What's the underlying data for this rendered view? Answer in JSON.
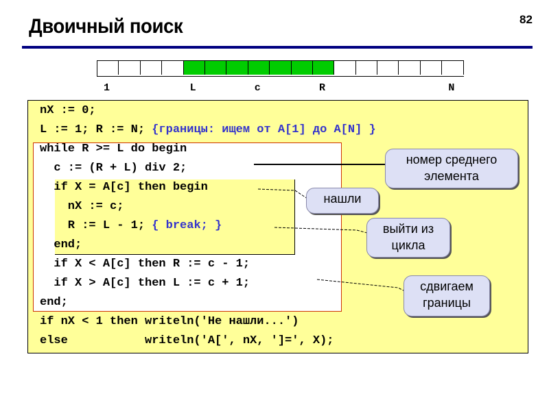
{
  "slide": {
    "title": "Двоичный поиск",
    "page_number": "82"
  },
  "array_diagram": {
    "cell_count": 17,
    "active_range": [
      5,
      11
    ],
    "active_color": "#00cc00",
    "markers": [
      {
        "label": "1",
        "cell": 1
      },
      {
        "label": "L",
        "cell": 5
      },
      {
        "label": "c",
        "cell": 8
      },
      {
        "label": "R",
        "cell": 11
      },
      {
        "label": "N",
        "cell": 17
      }
    ]
  },
  "code": {
    "lines": [
      {
        "text": "nX := 0;",
        "comment": ""
      },
      {
        "text": "L := 1; R := N; ",
        "comment": "{границы: ищем от A[1] до A[N] }"
      },
      {
        "text": "while R >= L do begin",
        "comment": ""
      },
      {
        "text": "  c := (R + L) div 2;",
        "comment": ""
      },
      {
        "text": "  if X = A[c] then begin",
        "comment": ""
      },
      {
        "text": "    nX := c;",
        "comment": ""
      },
      {
        "text": "    R := L - 1; ",
        "comment": "{ break; }"
      },
      {
        "text": "  end;",
        "comment": ""
      },
      {
        "text": "  if X < A[c] then R := c - 1;",
        "comment": ""
      },
      {
        "text": "  if X > A[c] then L := c + 1;",
        "comment": ""
      },
      {
        "text": "end;",
        "comment": ""
      },
      {
        "text": "if nX < 1 then writeln('Не нашли...')",
        "comment": ""
      },
      {
        "text": "else           writeln('A[', nX, ']=', X);",
        "comment": ""
      }
    ]
  },
  "callouts": {
    "middle": "номер среднего элемента",
    "middle_line1": "номер среднего",
    "middle_line2": "элемента",
    "found": "нашли",
    "exit_line1": "выйти из",
    "exit_line2": "цикла",
    "shift_line1": "сдвигаем",
    "shift_line2": "границы"
  },
  "colors": {
    "rule": "#000080",
    "code_bg": "#ffff99",
    "comment": "#3333cc",
    "loop_border": "#cc3300",
    "callout_bg": "#dde0f5"
  }
}
